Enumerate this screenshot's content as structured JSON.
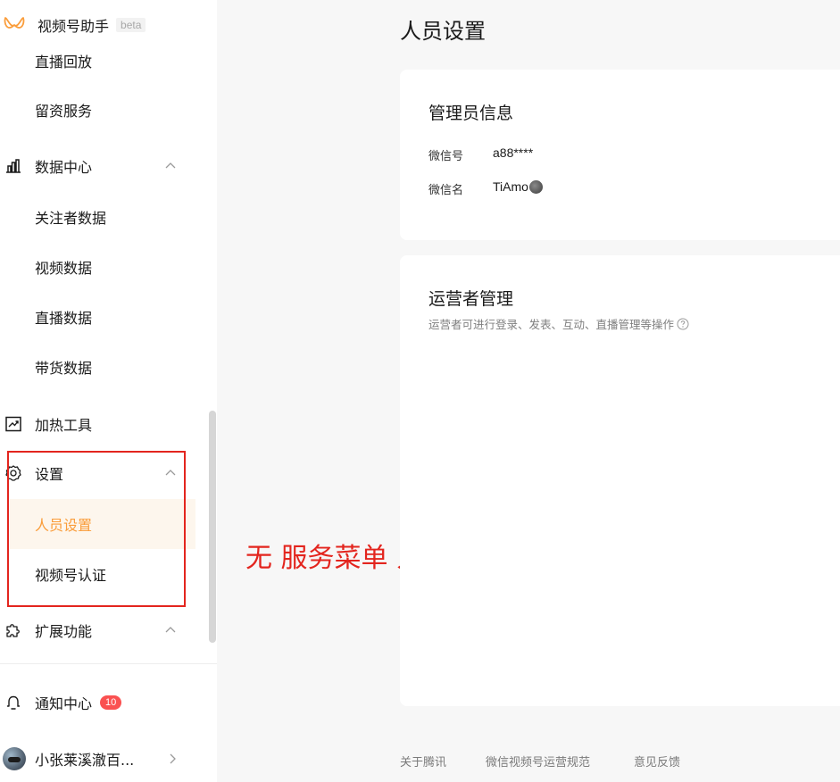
{
  "brand": {
    "name": "视频号助手",
    "tag": "beta"
  },
  "sidebar": {
    "items": [
      {
        "label": "直播回放"
      },
      {
        "label": "留资服务"
      },
      {
        "label": "数据中心"
      },
      {
        "label": "关注者数据"
      },
      {
        "label": "视频数据"
      },
      {
        "label": "直播数据"
      },
      {
        "label": "带货数据"
      },
      {
        "label": "加热工具"
      },
      {
        "label": "设置"
      },
      {
        "label": "人员设置"
      },
      {
        "label": "视频号认证"
      },
      {
        "label": "扩展功能"
      }
    ],
    "notifications": {
      "label": "通知中心",
      "count": "10"
    },
    "account": {
      "name": "小张莱溪澈百..."
    }
  },
  "annotation": {
    "text": "无 服务菜单 入口",
    "color": "#e3251e"
  },
  "main": {
    "title": "人员设置",
    "admin_card": {
      "title": "管理员信息",
      "wechat_id_label": "微信号",
      "wechat_id_value": "a88****",
      "wechat_name_label": "微信名",
      "wechat_name_value": "TiAmo"
    },
    "operator_card": {
      "title": "运营者管理",
      "description": "运营者可进行登录、发表、互动、直播管理等操作"
    }
  },
  "footer": {
    "links": [
      "关于腾讯",
      "微信视频号运营规范",
      "意见反馈"
    ]
  },
  "colors": {
    "accent": "#fa9d3b",
    "active_bg": "#fdf6ed",
    "badge": "#fa5151"
  }
}
